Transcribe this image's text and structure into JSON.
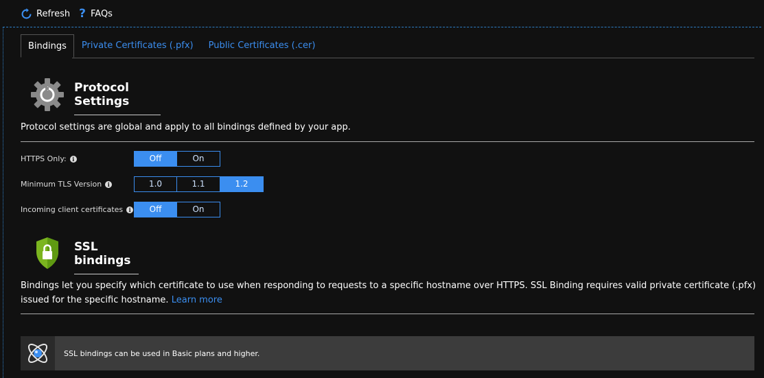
{
  "toolbar": {
    "refresh_label": "Refresh",
    "faqs_label": "FAQs",
    "faqs_glyph": "?"
  },
  "tabs": [
    {
      "label": "Bindings",
      "active": true
    },
    {
      "label": "Private Certificates (.pfx)",
      "active": false
    },
    {
      "label": "Public Certificates (.cer)",
      "active": false
    }
  ],
  "protocol": {
    "title": "Protocol Settings",
    "description": "Protocol settings are global and apply to all bindings defined by your app.",
    "icon": "gear-icon",
    "rows": [
      {
        "label": "HTTPS Only:",
        "options": [
          "Off",
          "On"
        ],
        "selected": "Off"
      },
      {
        "label": "Minimum TLS Version",
        "options": [
          "1.0",
          "1.1",
          "1.2"
        ],
        "selected": "1.2"
      },
      {
        "label": "Incoming client certificates",
        "options": [
          "Off",
          "On"
        ],
        "selected": "Off"
      }
    ]
  },
  "ssl": {
    "title": "SSL bindings",
    "icon": "shield-lock-icon",
    "description": "Bindings let you specify which certificate to use when responding to requests to a specific hostname over HTTPS. SSL Binding requires valid private certificate (.pfx) issued for the specific hostname.",
    "learn_more": "Learn more"
  },
  "notice": {
    "icon": "app-service-icon",
    "text": "SSL bindings can be used in Basic plans and higher."
  },
  "colors": {
    "accent": "#3b8ef0",
    "background": "#111111",
    "shield_green": "#7bb51f"
  }
}
